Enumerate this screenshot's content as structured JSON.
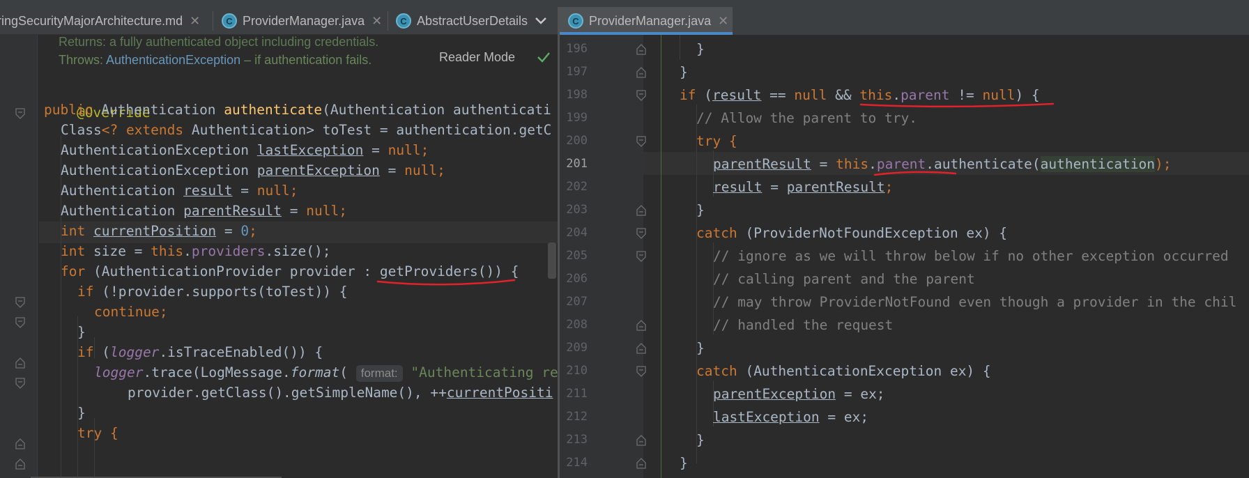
{
  "tabs_left": [
    {
      "label": "ringSecurityMajorArchitecture.md",
      "icon": "markdown-file-icon"
    },
    {
      "label": "ProviderManager.java",
      "icon": "java-class-icon"
    },
    {
      "label": "AbstractUserDetails",
      "icon": "java-class-icon"
    }
  ],
  "tabs_right": [
    {
      "label": "ProviderManager.java",
      "icon": "java-class-icon",
      "active": true
    }
  ],
  "doc": {
    "returns_line": "Returns: a fully authenticated object including credentials.",
    "throws_label": "Throws:",
    "throws_link": "AuthenticationException",
    "throws_text": " – if authentication fails."
  },
  "reader_mode_label": "Reader Mode",
  "left_code": {
    "override": "@Override",
    "l1": [
      "public ",
      "Authentication ",
      "authenticate",
      "(Authentication authenticati"
    ],
    "l2": [
      "Class",
      "<? ",
      "extends ",
      "Authentication> toTest = authentication.getC"
    ],
    "l3": [
      "AuthenticationException ",
      "lastException",
      " = ",
      "null",
      ";"
    ],
    "l4": [
      "AuthenticationException ",
      "parentException",
      " = ",
      "null",
      ";"
    ],
    "l5": [
      "Authentication ",
      "result",
      " = ",
      "null",
      ";"
    ],
    "l6": [
      "Authentication ",
      "parentResult",
      " = ",
      "null",
      ";"
    ],
    "l7": [
      "int ",
      "currentPosition",
      " = ",
      "0",
      ";"
    ],
    "l8": [
      "int ",
      "size = ",
      "this",
      ".",
      "providers",
      ".size();"
    ],
    "l9": [
      "for ",
      "(AuthenticationProvider provider : ",
      "getProviders",
      "()) {"
    ],
    "l10": [
      "if ",
      "(!provider.supports(toTest)) {"
    ],
    "l11": "continue;",
    "l12": "}",
    "l13": [
      "if ",
      "(",
      "logger",
      ".isTraceEnabled()) {"
    ],
    "l14": [
      "logger",
      ".trace(LogMessage.",
      "format",
      "(",
      "format:",
      " \"Authenticating re"
    ],
    "l15": [
      "provider.getClass().getSimpleName(), ++",
      "currentPositi"
    ],
    "l16": "}",
    "l17": "try {"
  },
  "right_lines": [
    {
      "n": "196"
    },
    {
      "n": "197"
    },
    {
      "n": "198"
    },
    {
      "n": "199"
    },
    {
      "n": "200"
    },
    {
      "n": "201",
      "current": true
    },
    {
      "n": "202"
    },
    {
      "n": "203"
    },
    {
      "n": "204"
    },
    {
      "n": "205"
    },
    {
      "n": "206"
    },
    {
      "n": "207"
    },
    {
      "n": "208"
    },
    {
      "n": "209"
    },
    {
      "n": "210"
    },
    {
      "n": "211"
    },
    {
      "n": "212"
    },
    {
      "n": "213"
    },
    {
      "n": "214"
    }
  ],
  "right_code": {
    "r196": "}",
    "r197": "}",
    "r198": [
      "if ",
      "(",
      "result",
      " == ",
      "null",
      " && ",
      "this",
      ".",
      "parent",
      " != ",
      "null",
      ") {"
    ],
    "r199": "// Allow the parent to try.",
    "r200": "try {",
    "r201": [
      "parentResult",
      " = ",
      "this",
      ".",
      "parent",
      ".authenticate(",
      "authentication",
      ");"
    ],
    "r202": [
      "result",
      " = ",
      "parentResult",
      ";"
    ],
    "r203": "}",
    "r204": [
      "catch ",
      "(ProviderNotFoundException ex) {"
    ],
    "r205": "// ignore as we will throw below if no other exception occurred",
    "r206": "// calling parent and the parent",
    "r207": "// may throw ProviderNotFound even though a provider in the chil",
    "r208": "// handled the request",
    "r209": "}",
    "r210": [
      "catch ",
      "(AuthenticationException ex) {"
    ],
    "r211": [
      "parentException",
      " = ex;"
    ],
    "r212": [
      "lastException",
      " = ex;"
    ],
    "r213": "}",
    "r214": "}"
  },
  "colors": {
    "background": "#2b2b2b",
    "keyword": "#cc7832",
    "function": "#ffc66d",
    "field": "#9876aa",
    "string": "#6a8759",
    "comment": "#808080",
    "annotation": "#bbb529",
    "number": "#6897bb",
    "red_underline": "#e0232b",
    "active_tab_underline": "#4a88c7"
  }
}
